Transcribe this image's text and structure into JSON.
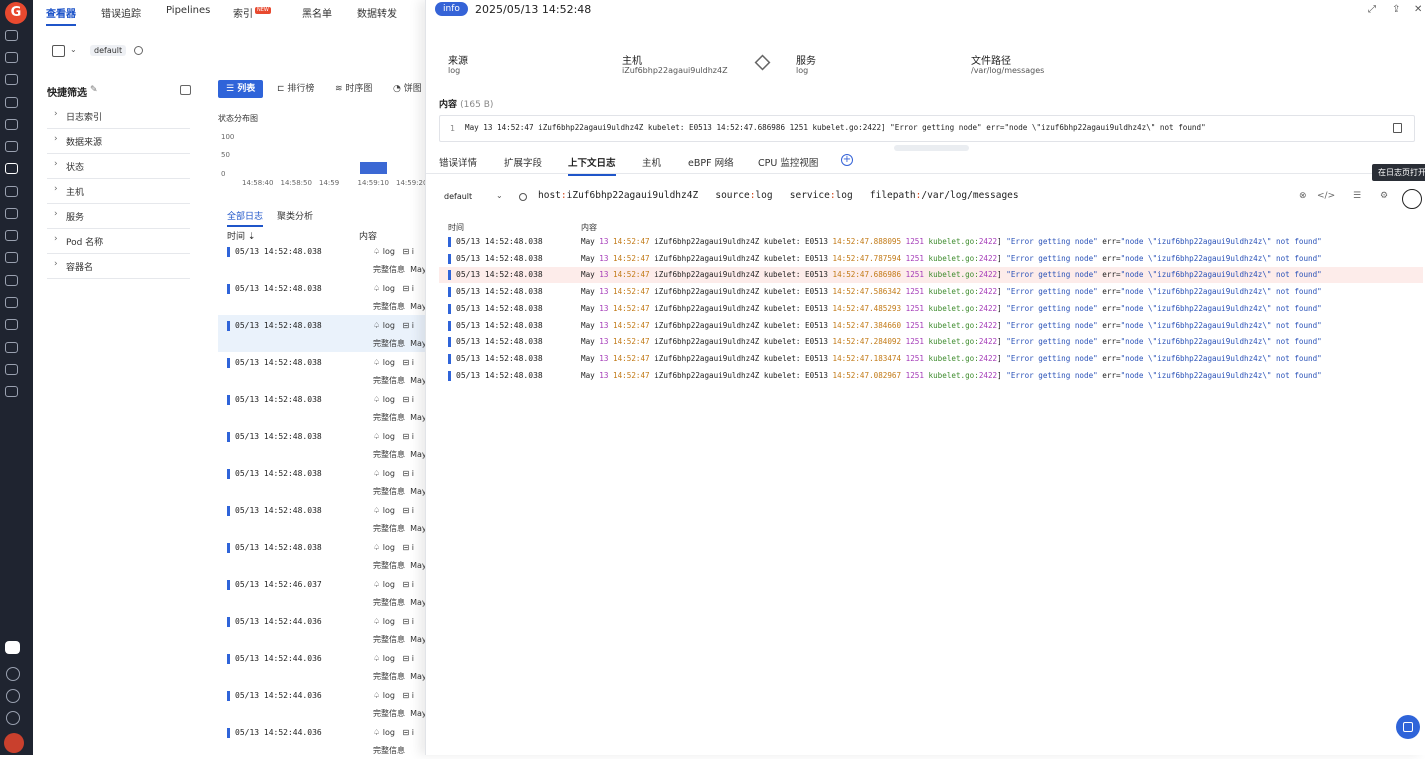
{
  "nav": {
    "tabs": [
      {
        "label": "查看器",
        "active": true
      },
      {
        "label": "错误追踪"
      },
      {
        "label": "Pipelines"
      },
      {
        "label": "索引",
        "badge": "NEW"
      },
      {
        "label": "黑名单"
      },
      {
        "label": "数据转发"
      }
    ]
  },
  "workspace": {
    "name": "default"
  },
  "quick_filter": {
    "title": "快捷筛选",
    "items": [
      "日志索引",
      "数据来源",
      "状态",
      "主机",
      "服务",
      "Pod 名称",
      "容器名"
    ]
  },
  "view_tabs": [
    {
      "label": "列表",
      "active": true
    },
    {
      "label": "排行榜"
    },
    {
      "label": "时序图"
    },
    {
      "label": "饼图"
    }
  ],
  "distribution": {
    "title": "状态分布图"
  },
  "chart_data": {
    "type": "bar",
    "categories": [
      "14:58:40",
      "14:58:50",
      "14:59",
      "14:59:10",
      "14:59:20"
    ],
    "y_ticks": [
      "100",
      "50",
      "0"
    ],
    "values": [
      0,
      0,
      0,
      20,
      0
    ],
    "ylim": [
      0,
      100
    ]
  },
  "list_subtabs": [
    {
      "label": "全部日志",
      "active": true
    },
    {
      "label": "聚类分析"
    }
  ],
  "list_header": {
    "time": "时间",
    "content": "内容"
  },
  "log_rows": [
    {
      "time": "05/13 14:52:48.038",
      "source": "log",
      "full": "完整信息",
      "msg": "May"
    },
    {
      "time": "05/13 14:52:48.038",
      "source": "log",
      "full": "完整信息",
      "msg": "May"
    },
    {
      "time": "05/13 14:52:48.038",
      "source": "log",
      "full": "完整信息",
      "msg": "May",
      "selected": true
    },
    {
      "time": "05/13 14:52:48.038",
      "source": "log",
      "full": "完整信息",
      "msg": "May"
    },
    {
      "time": "05/13 14:52:48.038",
      "source": "log",
      "full": "完整信息",
      "msg": "May"
    },
    {
      "time": "05/13 14:52:48.038",
      "source": "log",
      "full": "完整信息",
      "msg": "May"
    },
    {
      "time": "05/13 14:52:48.038",
      "source": "log",
      "full": "完整信息",
      "msg": "May"
    },
    {
      "time": "05/13 14:52:48.038",
      "source": "log",
      "full": "完整信息",
      "msg": "May"
    },
    {
      "time": "05/13 14:52:48.038",
      "source": "log",
      "full": "完整信息",
      "msg": "May"
    },
    {
      "time": "05/13 14:52:46.037",
      "source": "log",
      "full": "完整信息",
      "msg": "May"
    },
    {
      "time": "05/13 14:52:44.036",
      "source": "log",
      "full": "完整信息",
      "msg": "May"
    },
    {
      "time": "05/13 14:52:44.036",
      "source": "log",
      "full": "完整信息",
      "msg": "May"
    },
    {
      "time": "05/13 14:52:44.036",
      "source": "log",
      "full": "完整信息",
      "msg": "May"
    },
    {
      "time": "05/13 14:52:44.036",
      "source": "log",
      "full": "完整信息",
      "msg": ""
    }
  ],
  "detail": {
    "status": "info",
    "timestamp": "2025/05/13 14:52:48",
    "meta": [
      {
        "label": "来源",
        "value": "log"
      },
      {
        "label": "主机",
        "value": "iZuf6bhp22agaui9uldhz4Z"
      },
      {
        "label": "服务",
        "value": "log"
      },
      {
        "label": "文件路径",
        "value": "/var/log/messages"
      }
    ],
    "content_label": "内容",
    "content_size": "(165 B)",
    "content_line_no": "1",
    "content_text": "May 13 14:52:47 iZuf6bhp22agaui9uldhz4Z kubelet: E0513 14:52:47.686986    1251 kubelet.go:2422] \"Error getting node\" err=\"node \\\"izuf6bhp22agaui9uldhz4z\\\" not found\"",
    "tabs": [
      {
        "label": "错误详情"
      },
      {
        "label": "扩展字段"
      },
      {
        "label": "上下文日志",
        "active": true
      },
      {
        "label": "主机"
      },
      {
        "label": "eBPF 网络"
      },
      {
        "label": "CPU 监控视图"
      }
    ],
    "tooltip": "在日志页打开",
    "context": {
      "workspace": "default",
      "query": [
        {
          "key": "host",
          "value": "iZuf6bhp22agaui9uldhz4Z"
        },
        {
          "key": "source",
          "value": "log"
        },
        {
          "key": "service",
          "value": "log"
        },
        {
          "key": "filepath",
          "value": "/var/log/messages"
        }
      ],
      "header": {
        "time": "时间",
        "content": "内容"
      },
      "rows": [
        {
          "time": "05/13 14:52:48.038",
          "ts": "14:52:47.888095"
        },
        {
          "time": "05/13 14:52:48.038",
          "ts": "14:52:47.787594"
        },
        {
          "time": "05/13 14:52:48.038",
          "ts": "14:52:47.686986",
          "highlight": true
        },
        {
          "time": "05/13 14:52:48.038",
          "ts": "14:52:47.586342"
        },
        {
          "time": "05/13 14:52:48.038",
          "ts": "14:52:47.485293"
        },
        {
          "time": "05/13 14:52:48.038",
          "ts": "14:52:47.384660"
        },
        {
          "time": "05/13 14:52:48.038",
          "ts": "14:52:47.284092"
        },
        {
          "time": "05/13 14:52:48.038",
          "ts": "14:52:47.183474"
        },
        {
          "time": "05/13 14:52:48.038",
          "ts": "14:52:47.082967"
        }
      ],
      "msg_prefix_month": "May",
      "msg_day": "13",
      "msg_time": "14:52:47",
      "msg_host": "iZuf6bhp22agaui9uldhz4Z kubelet: E0513",
      "msg_pid": "1251",
      "msg_file": "kubelet.go:",
      "msg_line": "2422",
      "msg_err": "\"Error getting node\"",
      "msg_tail_a": "err=",
      "msg_tail_b": "\"node \\\"izuf6bhp22agaui9uldhz4z\\\" not found\""
    }
  }
}
